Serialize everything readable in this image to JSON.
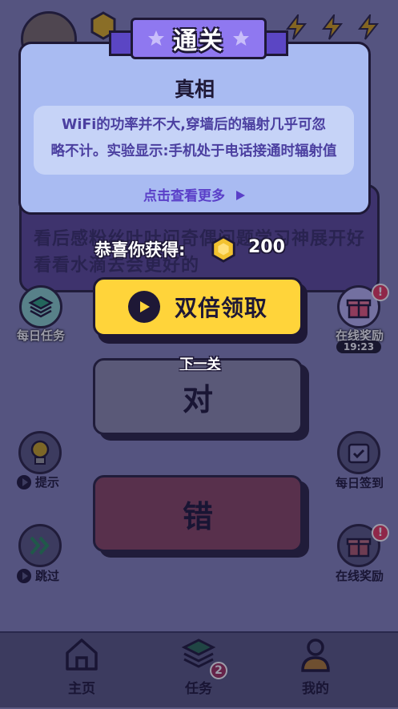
{
  "question": {
    "text": "看后感粉丝吐吐问奇偶问题学习神展开好看看水滴去会更好的"
  },
  "left_side": {
    "daily_tasks": "每日任务",
    "hint": "提示",
    "skip": "跳过"
  },
  "right_side": {
    "online_reward_top": "在线奖励",
    "online_reward_badge": "!",
    "timer": "19:23",
    "daily_checkin": "每日签到",
    "online_reward_bottom": "在线奖励",
    "online_reward_bottom_badge": "!"
  },
  "answers": {
    "correct": "对",
    "wrong": "错"
  },
  "nav": {
    "home": "主页",
    "tasks": "任务",
    "tasks_badge": "2",
    "me": "我的"
  },
  "modal": {
    "banner": "通关",
    "heading": "真相",
    "text_line1": "WiFi的功率并不大,穿墙后的辐射几乎可忽",
    "text_line2": "略不计。实验显示:手机处于电话接通时辐射值",
    "more": "点击查看更多",
    "reward_label": "恭喜你获得:",
    "reward_amount": "200",
    "double_button": "双倍领取",
    "next_link": "下一关"
  },
  "colors": {
    "modal_bg": "#a9bbf2",
    "double_button": "#ffd43a",
    "banner": "#8f78f0",
    "correct_button": "#8e8cab",
    "wrong_button": "#8a4660",
    "badge": "#e8365a"
  }
}
